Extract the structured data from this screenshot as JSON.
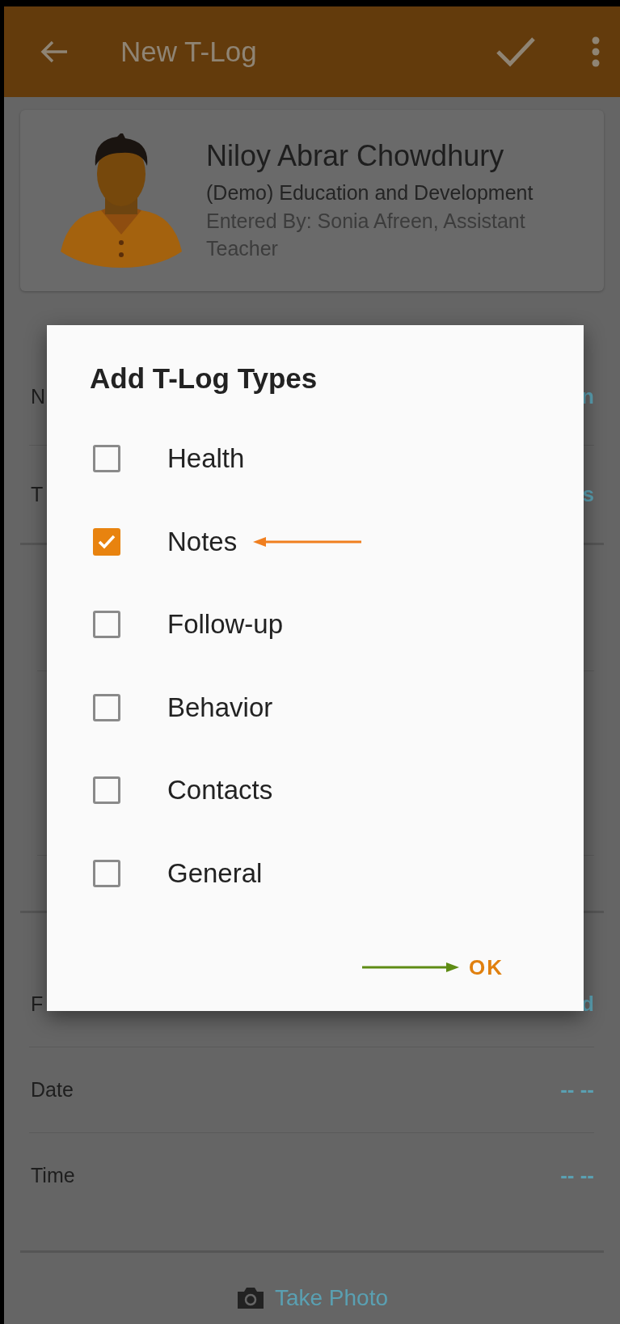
{
  "app_bar": {
    "title": "New T-Log"
  },
  "profile": {
    "name": "Niloy Abrar Chowdhury",
    "organization": "(Demo) Education and Development",
    "entered_by": "Entered By: Sonia Afreen, Assistant Teacher"
  },
  "form_sections": [
    {
      "rows": [
        {
          "label": "N",
          "value": "n"
        },
        {
          "label": "T",
          "value": "s"
        }
      ]
    },
    {
      "rows": [
        {
          "label": "F",
          "value": "d"
        },
        {
          "label": "Date",
          "value": "-- --"
        },
        {
          "label": "Time",
          "value": "-- --"
        }
      ]
    }
  ],
  "photo_button": {
    "label": "Take Photo"
  },
  "dialog": {
    "title": "Add T-Log Types",
    "options": [
      {
        "label": "Health",
        "checked": false,
        "arrow": false
      },
      {
        "label": "Notes",
        "checked": true,
        "arrow": true
      },
      {
        "label": "Follow-up",
        "checked": false,
        "arrow": false
      },
      {
        "label": "Behavior",
        "checked": false,
        "arrow": false
      },
      {
        "label": "Contacts",
        "checked": false,
        "arrow": false
      },
      {
        "label": "General",
        "checked": false,
        "arrow": false
      }
    ],
    "ok_button": "OK"
  }
}
